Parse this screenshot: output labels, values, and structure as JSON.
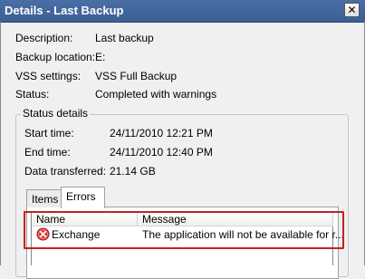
{
  "window": {
    "title": "Details - Last Backup",
    "close_label": "✕"
  },
  "details": [
    {
      "label": "Description:",
      "value": "Last backup"
    },
    {
      "label": "Backup location:",
      "value": "E:"
    },
    {
      "label": "VSS settings:",
      "value": "VSS Full Backup"
    },
    {
      "label": "Status:",
      "value": "Completed with warnings"
    }
  ],
  "status_details": {
    "title": "Status details",
    "rows": [
      {
        "label": "Start time:",
        "value": "24/11/2010 12:21 PM"
      },
      {
        "label": "End time:",
        "value": "24/11/2010 12:40 PM"
      },
      {
        "label": "Data transferred:",
        "value": "21.14 GB"
      }
    ]
  },
  "tabs": [
    {
      "label": "Items",
      "selected": false
    },
    {
      "label": "Errors",
      "selected": true
    }
  ],
  "errors_list": {
    "columns": [
      "Name",
      "Message"
    ],
    "rows": [
      {
        "icon": "error-icon",
        "name": "Exchange",
        "message": "The application will not be available for r..."
      }
    ]
  },
  "colors": {
    "highlight": "#c42121",
    "error_icon": "#d93a3a"
  }
}
